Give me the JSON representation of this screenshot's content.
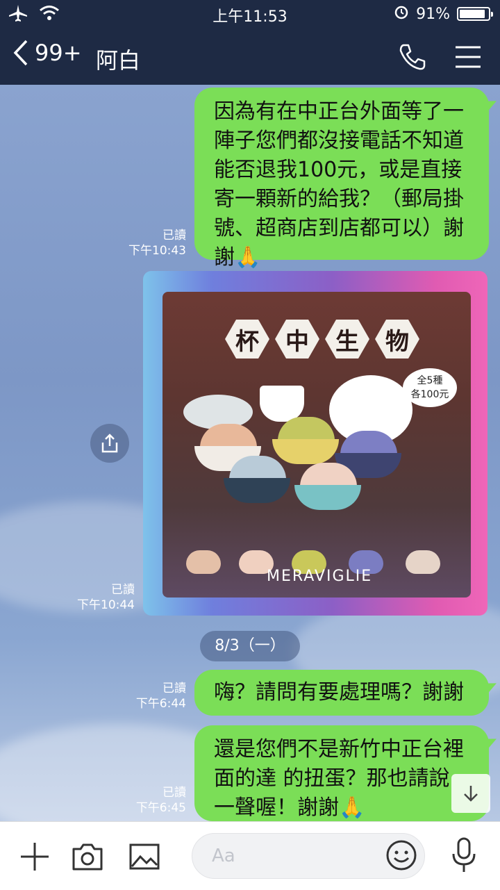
{
  "status_bar": {
    "time": "上午11:53",
    "battery": "91%",
    "battery_level": 0.91
  },
  "header": {
    "back_count": "99+",
    "title": "阿白"
  },
  "messages": [
    {
      "type": "text",
      "read": "已讀",
      "time": "下午10:43",
      "lines": [
        "因為有在中正台外面等了一",
        "陣子您們都沒接電話不知道",
        "能否退我100元，或是直接",
        "寄一顆新的給我？（郵局掛",
        "號、超商店到店都可以）謝",
        "謝🙏"
      ]
    },
    {
      "type": "image",
      "read": "已讀",
      "time": "下午10:44",
      "image_text": {
        "title_chars": [
          "杯",
          "中",
          "生",
          "物"
        ],
        "badge_line1": "全5種",
        "badge_line2": "各100元",
        "brand": "MERAVIGLIE"
      }
    },
    {
      "type": "text",
      "read": "已讀",
      "time": "下午6:44",
      "lines": [
        "嗨？請問有要處理嗎？謝謝"
      ]
    },
    {
      "type": "text",
      "read": "已讀",
      "time": "下午6:45",
      "lines": [
        "還是您們不是新竹中正台裡",
        "面的達 的扭蛋？那也請說",
        "一聲喔！謝謝🙏"
      ]
    }
  ],
  "date_separator": "8/3（一）",
  "input": {
    "placeholder": "Aa"
  },
  "colors": {
    "header_bg": "#1e2a44",
    "bubble": "#7bde57"
  }
}
